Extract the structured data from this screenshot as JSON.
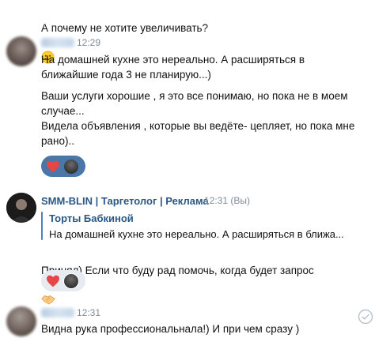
{
  "messages": [
    {
      "text": "А почему не хотите увеличивать?",
      "emoji": "slightly-smiling-face"
    },
    {
      "author": "",
      "time": "12:29",
      "lines": [
        "На домашней кухне это нереально. А расширяться в\nближайшие года 3 не планирую...)",
        "Ваши услуги хорошие , я это все понимаю, но пока не в моем\nслучае...\nВидела объявления , которые вы ведёте- цепляет, но пока мне\nрано).."
      ],
      "reactions": {
        "emoji": "heart-icon",
        "active": true
      }
    },
    {
      "author": "SMM-BLIN | Таргетолог | Реклама",
      "time": "12:31 (Вы)",
      "reply": {
        "title": "Торты Бабкиной",
        "text": "На домашней кухне это нереально. А расширяться в ближа..."
      },
      "text": "Принял) Если что буду рад помочь, когда будет запрос",
      "emoji": "handshake",
      "reactions": {
        "emoji": "heart-icon",
        "active": false
      }
    },
    {
      "author": "",
      "time": "12:31",
      "text": "Видна рука профессиональнала!) И при чем сразу )"
    }
  ],
  "colors": {
    "link": "#2a5885",
    "accent": "#4a76a8",
    "reaction_bg": "#e5ebf1",
    "heart": "#e64646",
    "time": "#818c99"
  }
}
